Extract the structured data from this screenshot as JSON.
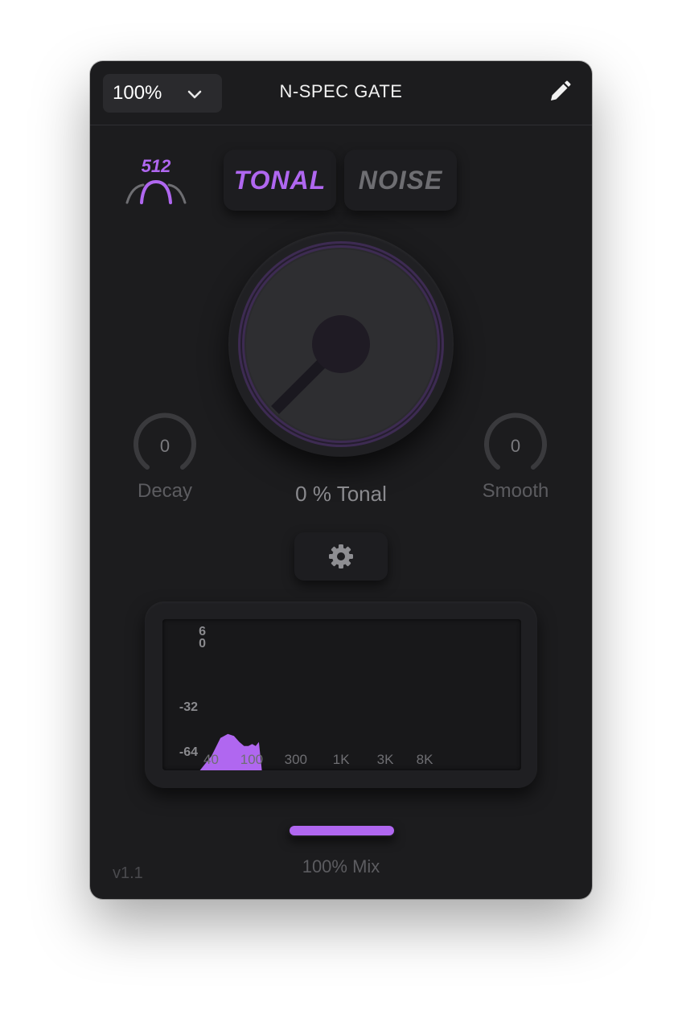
{
  "window": {
    "title": "N-SPEC GATE",
    "version": "v1.1"
  },
  "toolbar": {
    "zoom_value": "100%",
    "dropdown_icon": "chevron-down-icon",
    "edit_icon": "pencil-icon"
  },
  "fft": {
    "size": "512",
    "icon": "bell-curve-icon"
  },
  "modes": {
    "tonal_label": "TONAL",
    "noise_label": "NOISE",
    "selected": "TONAL"
  },
  "main_knob": {
    "value": 0,
    "value_text": "0 % Tonal"
  },
  "decay": {
    "value": "0",
    "label": "Decay"
  },
  "smooth": {
    "value": "0",
    "label": "Smooth"
  },
  "settings": {
    "icon": "gear-icon"
  },
  "analyzer": {
    "db_labels": [
      "6",
      "0",
      "-32",
      "-64"
    ],
    "freq_labels": [
      "40",
      "100",
      "300",
      "1K",
      "3K",
      "8K"
    ],
    "spectrum_hz": [
      30,
      40,
      50,
      60,
      70,
      80,
      90,
      100,
      110,
      120,
      130,
      140,
      150
    ],
    "spectrum_db": [
      -70,
      -56,
      -47,
      -45,
      -46,
      -49,
      -51,
      -51,
      -50,
      -51,
      -49,
      -70,
      -70
    ]
  },
  "mix": {
    "value": 1.0,
    "label": "100% Mix"
  },
  "colors": {
    "accent": "#b067f0",
    "background": "#1c1c1e",
    "text_muted": "#5c5c60"
  }
}
